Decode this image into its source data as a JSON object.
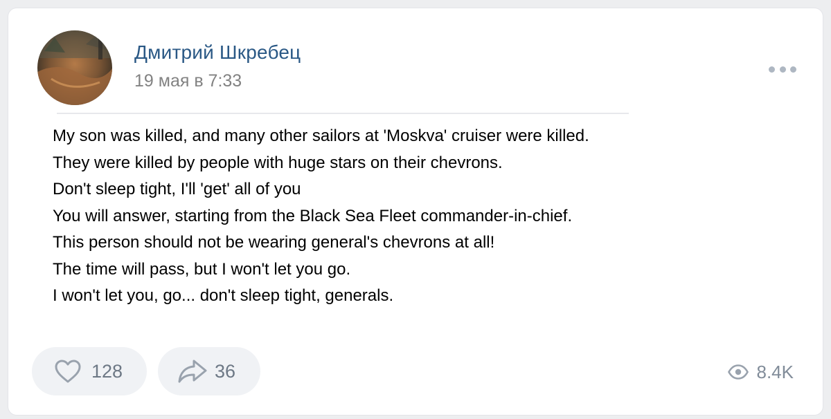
{
  "post": {
    "author": "Дмитрий Шкребец",
    "date": "19 мая в 7:33",
    "more_icon": "more-horizontal-icon",
    "text_lines": [
      "My son was killed, and many other sailors at 'Moskva' cruiser were killed.",
      "They were killed by people with huge stars on their chevrons.",
      "Don't sleep tight, I'll 'get' all of you",
      "You will answer, starting from the Black Sea Fleet commander-in-chief.",
      "This person should not be wearing general's chevrons at all!",
      "The time will pass, but I won't let you go.",
      "I won't let you, go... don't sleep tight, generals."
    ]
  },
  "actions": {
    "likes": {
      "icon": "heart-icon",
      "count": "128"
    },
    "shares": {
      "icon": "share-arrow-icon",
      "count": "36"
    },
    "views": {
      "icon": "eye-icon",
      "count": "8.4K"
    }
  },
  "colors": {
    "author_link": "#2a5885",
    "secondary_text": "#828282",
    "icon_gray": "#99a2ad",
    "button_bg": "#f0f2f5"
  }
}
